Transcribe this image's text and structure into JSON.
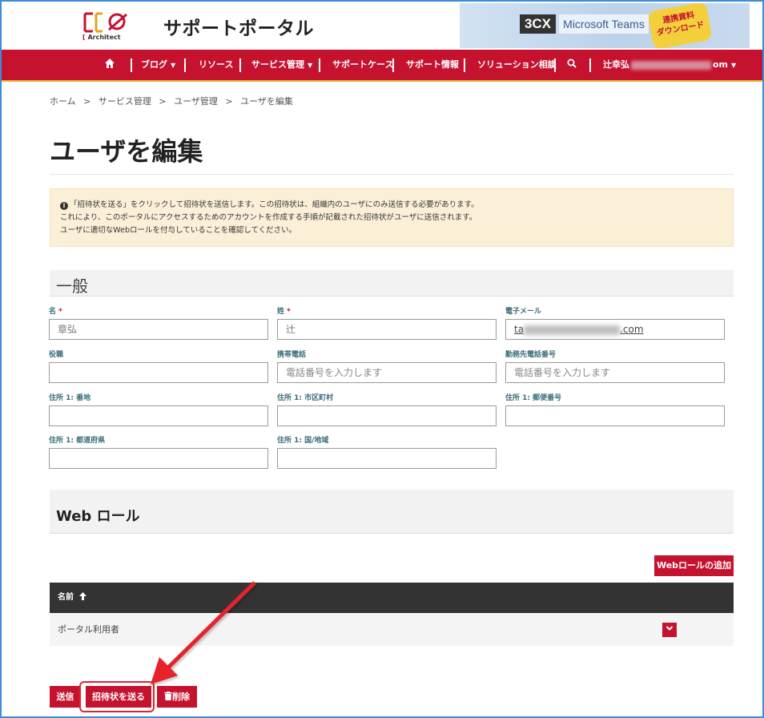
{
  "header": {
    "logo_prefix": "[",
    "logo_text": "Architect",
    "site_title": "サポートポータル",
    "banner": {
      "cx": "3CX",
      "ms": "Microsoft Teams",
      "badge_line1": "連携資料",
      "badge_line2": "ダウンロード"
    }
  },
  "nav": {
    "items": [
      "ブログ",
      "リソース",
      "サービス管理",
      "サポートケース",
      "サポート情報",
      "ソリューション相談"
    ],
    "user_label": "辻幸弘",
    "user_suffix": "om"
  },
  "breadcrumb": [
    "ホーム",
    ">",
    "サービス管理",
    ">",
    "ユーザ管理",
    ">",
    "ユーザを編集"
  ],
  "page_title": "ユーザを編集",
  "notice": {
    "line1": "「招待状を送る」をクリックして招待状を送信します。この招待状は、組織内のユーザにのみ送信する必要があります。",
    "line2": "これにより、このポータルにアクセスするためのアカウントを作成する手順が記載された招待状がユーザに送信されます。",
    "line3": "ユーザに適切なWebロールを付与していることを確認してください。"
  },
  "general": {
    "title": "一般",
    "fields": {
      "first_name": {
        "label": "名",
        "required": "*",
        "value": "章弘"
      },
      "last_name": {
        "label": "姓",
        "required": "*",
        "value": "辻"
      },
      "email": {
        "label": "電子メール",
        "value_start": "ta",
        "value_end": ".com"
      },
      "job_title": {
        "label": "役職",
        "value": ""
      },
      "mobile": {
        "label": "携帯電話",
        "placeholder": "電話番号を入力します"
      },
      "work_phone": {
        "label": "勤務先電話番号",
        "placeholder": "電話番号を入力します"
      },
      "street": {
        "label": "住所 1: 番地",
        "value": ""
      },
      "city": {
        "label": "住所 1: 市区町村",
        "value": ""
      },
      "postal": {
        "label": "住所 1: 郵便番号",
        "value": ""
      },
      "state": {
        "label": "住所 1: 都道府県",
        "value": ""
      },
      "country": {
        "label": "住所 1: 国/地域",
        "value": ""
      }
    }
  },
  "web_roles": {
    "title": "Web ロール",
    "add_button": "Webロールの追加",
    "column_name": "名前",
    "sort_indicator": "🡅",
    "rows": [
      "ポータル利用者"
    ]
  },
  "actions": {
    "submit": "送信",
    "send_invite": "招待状を送る",
    "delete": "削除"
  }
}
